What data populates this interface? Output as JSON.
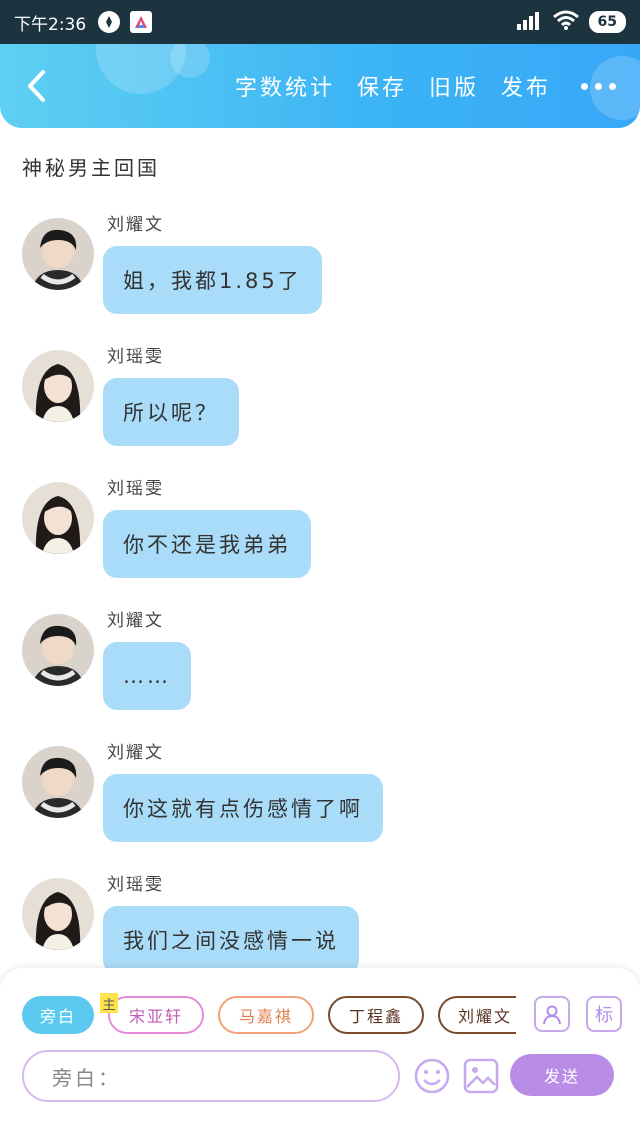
{
  "status_bar": {
    "time": "下午2:36",
    "battery": "65"
  },
  "header": {
    "actions": [
      "字数统计",
      "保存",
      "旧版",
      "发布"
    ],
    "more_icon": "more-dots-icon",
    "back_icon": "chevron-left-icon"
  },
  "story_title": "神秘男主回国",
  "messages": [
    {
      "speaker": "刘耀文",
      "text": "姐，我都1.85了",
      "avatar": "male"
    },
    {
      "speaker": "刘瑶雯",
      "text": "所以呢？",
      "avatar": "female"
    },
    {
      "speaker": "刘瑶雯",
      "text": "你不还是我弟弟",
      "avatar": "female"
    },
    {
      "speaker": "刘耀文",
      "text": "……",
      "avatar": "male"
    },
    {
      "speaker": "刘耀文",
      "text": "你这就有点伤感情了啊",
      "avatar": "male"
    },
    {
      "speaker": "刘瑶雯",
      "text": "我们之间没感情一说",
      "avatar": "female"
    }
  ],
  "composer": {
    "roles": [
      "旁白",
      "宋亚轩",
      "马嘉祺",
      "丁程鑫",
      "刘耀文"
    ],
    "main_tag": "主",
    "label_button": "标",
    "input_placeholder": "旁白：",
    "send_label": "发送"
  },
  "colors": {
    "header_start": "#5fd0f2",
    "header_end": "#37a8f8",
    "bubble": "#a9dcf8",
    "send": "#b98de6"
  }
}
